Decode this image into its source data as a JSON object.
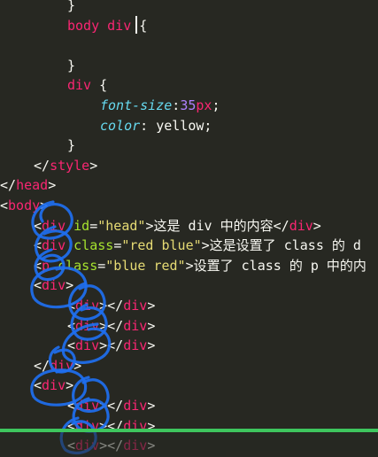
{
  "editor": {
    "language": "html",
    "lines": [
      {
        "indent": 76,
        "tokens": [
          {
            "t": "}",
            "c": "punc"
          }
        ]
      },
      {
        "indent": 76,
        "tokens": [
          {
            "t": "body div",
            "c": "tag"
          },
          {
            "t": " {",
            "c": "punc"
          }
        ]
      },
      {
        "indent": 76,
        "tokens": [
          {
            "t": "",
            "c": "text"
          }
        ]
      },
      {
        "indent": 76,
        "tokens": [
          {
            "t": "}",
            "c": "punc"
          }
        ]
      },
      {
        "indent": 76,
        "tokens": [
          {
            "t": "div",
            "c": "tag"
          },
          {
            "t": " {",
            "c": "punc"
          }
        ]
      },
      {
        "indent": 113,
        "tokens": [
          {
            "t": "font-size",
            "c": "prop"
          },
          {
            "t": ":",
            "c": "punc"
          },
          {
            "t": "35",
            "c": "num"
          },
          {
            "t": "px",
            "c": "tag"
          },
          {
            "t": ";",
            "c": "punc"
          }
        ]
      },
      {
        "indent": 113,
        "tokens": [
          {
            "t": "color",
            "c": "prop"
          },
          {
            "t": ": ",
            "c": "punc"
          },
          {
            "t": "yellow",
            "c": "val"
          },
          {
            "t": ";",
            "c": "punc"
          }
        ]
      },
      {
        "indent": 76,
        "tokens": [
          {
            "t": "}",
            "c": "punc"
          }
        ]
      },
      {
        "indent": 38,
        "tokens": [
          {
            "t": "</",
            "c": "punc"
          },
          {
            "t": "style",
            "c": "tag"
          },
          {
            "t": ">",
            "c": "punc"
          }
        ]
      },
      {
        "indent": 0,
        "tokens": [
          {
            "t": "</",
            "c": "punc"
          },
          {
            "t": "head",
            "c": "tag"
          },
          {
            "t": ">",
            "c": "punc"
          }
        ]
      },
      {
        "indent": 0,
        "tokens": [
          {
            "t": "<",
            "c": "punc"
          },
          {
            "t": "body",
            "c": "tag"
          },
          {
            "t": ">",
            "c": "punc"
          }
        ]
      },
      {
        "indent": 38,
        "tokens": [
          {
            "t": "<",
            "c": "punc"
          },
          {
            "t": "div",
            "c": "tag"
          },
          {
            "t": " ",
            "c": "text"
          },
          {
            "t": "id",
            "c": "attr"
          },
          {
            "t": "=",
            "c": "punc"
          },
          {
            "t": "\"head\"",
            "c": "str"
          },
          {
            "t": ">这是 div 中的内容</",
            "c": "text"
          },
          {
            "t": "div",
            "c": "tag"
          },
          {
            "t": ">",
            "c": "punc"
          }
        ]
      },
      {
        "indent": 38,
        "tokens": [
          {
            "t": "<",
            "c": "punc"
          },
          {
            "t": "div",
            "c": "tag"
          },
          {
            "t": " ",
            "c": "text"
          },
          {
            "t": "class",
            "c": "attr"
          },
          {
            "t": "=",
            "c": "punc"
          },
          {
            "t": "\"red blue\"",
            "c": "str"
          },
          {
            "t": ">这是设置了 class 的 d",
            "c": "text"
          }
        ]
      },
      {
        "indent": 38,
        "tokens": [
          {
            "t": "<",
            "c": "punc"
          },
          {
            "t": "p",
            "c": "tag"
          },
          {
            "t": " ",
            "c": "text"
          },
          {
            "t": "class",
            "c": "attr"
          },
          {
            "t": "=",
            "c": "punc"
          },
          {
            "t": "\"blue red\"",
            "c": "str"
          },
          {
            "t": ">设置了 class 的 p 中的内",
            "c": "text"
          }
        ]
      },
      {
        "indent": 38,
        "tokens": [
          {
            "t": "<",
            "c": "punc"
          },
          {
            "t": "div",
            "c": "tag"
          },
          {
            "t": ">",
            "c": "punc"
          }
        ]
      },
      {
        "indent": 76,
        "tokens": [
          {
            "t": "<",
            "c": "punc"
          },
          {
            "t": "div",
            "c": "tag"
          },
          {
            "t": "></",
            "c": "punc"
          },
          {
            "t": "div",
            "c": "tag"
          },
          {
            "t": ">",
            "c": "punc"
          }
        ]
      },
      {
        "indent": 76,
        "tokens": [
          {
            "t": "<",
            "c": "punc"
          },
          {
            "t": "div",
            "c": "tag"
          },
          {
            "t": "></",
            "c": "punc"
          },
          {
            "t": "div",
            "c": "tag"
          },
          {
            "t": ">",
            "c": "punc"
          }
        ]
      },
      {
        "indent": 76,
        "tokens": [
          {
            "t": "<",
            "c": "punc"
          },
          {
            "t": "div",
            "c": "tag"
          },
          {
            "t": "></",
            "c": "punc"
          },
          {
            "t": "div",
            "c": "tag"
          },
          {
            "t": ">",
            "c": "punc"
          }
        ]
      },
      {
        "indent": 38,
        "tokens": [
          {
            "t": "</",
            "c": "punc"
          },
          {
            "t": "div",
            "c": "tag"
          },
          {
            "t": ">",
            "c": "punc"
          }
        ]
      },
      {
        "indent": 38,
        "tokens": [
          {
            "t": "<",
            "c": "punc"
          },
          {
            "t": "div",
            "c": "tag"
          },
          {
            "t": ">",
            "c": "punc"
          }
        ]
      },
      {
        "indent": 76,
        "tokens": [
          {
            "t": "<",
            "c": "punc"
          },
          {
            "t": "div",
            "c": "tag"
          },
          {
            "t": "></",
            "c": "punc"
          },
          {
            "t": "div",
            "c": "tag"
          },
          {
            "t": ">",
            "c": "punc"
          }
        ]
      },
      {
        "indent": 76,
        "tokens": [
          {
            "t": "<",
            "c": "punc"
          },
          {
            "t": "div",
            "c": "tag"
          },
          {
            "t": "></",
            "c": "punc"
          },
          {
            "t": "div",
            "c": "tag"
          },
          {
            "t": ">",
            "c": "punc"
          }
        ]
      },
      {
        "indent": 76,
        "tokens": [
          {
            "t": "<",
            "c": "punc"
          },
          {
            "t": "div",
            "c": "tag"
          },
          {
            "t": "></",
            "c": "punc"
          },
          {
            "t": "div",
            "c": "tag"
          },
          {
            "t": ">",
            "c": "punc"
          }
        ]
      }
    ]
  },
  "theme": {
    "background": "#272822",
    "tag": "#f92672",
    "attribute": "#a6e22e",
    "string": "#e6db74",
    "number": "#ae81ff",
    "property": "#66d9ef",
    "text": "#f8f8f2",
    "annotation": "#1e6ff0",
    "status_bar": "#3ec65e"
  }
}
